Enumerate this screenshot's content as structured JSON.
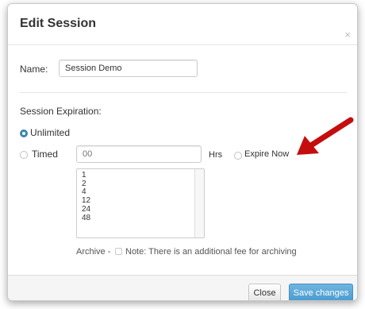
{
  "modal": {
    "title": "Edit Session",
    "close_glyph": "×"
  },
  "name": {
    "label": "Name:",
    "value": "Session Demo"
  },
  "expiration": {
    "section_label": "Session Expiration:",
    "unlimited_label": "Unlimited",
    "unlimited_selected": true,
    "timed_label": "Timed",
    "timed_selected": false,
    "timed_placeholder": "00",
    "hrs_label": "Hrs",
    "expire_now_label": "Expire Now",
    "expire_now_selected": false,
    "hour_options": [
      "1",
      "2",
      "4",
      "12",
      "24",
      "48"
    ]
  },
  "archive": {
    "label": "Archive -",
    "checked": false,
    "note": "Note: There is an additional fee for archiving"
  },
  "footer": {
    "close_label": "Close",
    "save_label": "Save changes"
  },
  "colors": {
    "primary": "#4a9ccf",
    "radio_selected": "#3a87ad",
    "annotation_arrow": "#c40d0d"
  },
  "icons": {
    "annotation": "red-arrow-icon"
  }
}
